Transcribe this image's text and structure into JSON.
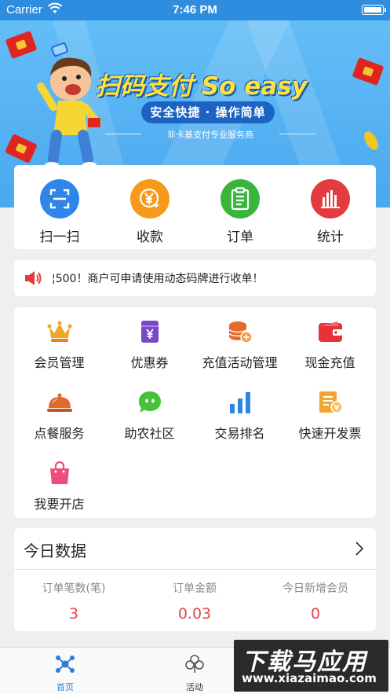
{
  "status_bar": {
    "carrier": "Carrier",
    "time": "7:46 PM"
  },
  "banner": {
    "headline": "扫码支付 So easy",
    "pill": "安全快捷 · 操作简单",
    "subline": "非卡基支付专业服务商"
  },
  "quick_actions": [
    {
      "label": "扫一扫",
      "icon": "scan-icon",
      "color": "#2f86e8"
    },
    {
      "label": "收款",
      "icon": "yuan-coin-icon",
      "color": "#f59a1b"
    },
    {
      "label": "订单",
      "icon": "clipboard-icon",
      "color": "#38b63c"
    },
    {
      "label": "统计",
      "icon": "bar-chart-icon",
      "color": "#e33b3f"
    }
  ],
  "notice": {
    "text": "500！商户可申请使用动态码牌进行收单！",
    "prefix": "¦"
  },
  "services": [
    {
      "label": "会员管理",
      "icon": "crown-icon",
      "color": "#f2a52b"
    },
    {
      "label": "优惠券",
      "icon": "coupon-icon",
      "color": "#7a47c8"
    },
    {
      "label": "充值活动管理",
      "icon": "coin-stack-icon",
      "color": "#e66a2c"
    },
    {
      "label": "现金充值",
      "icon": "wallet-icon",
      "color": "#e6333a"
    },
    {
      "label": "点餐服务",
      "icon": "cloche-icon",
      "color": "#e06a2e"
    },
    {
      "label": "助农社区",
      "icon": "chat-bubble-icon",
      "color": "#48c13a"
    },
    {
      "label": "交易排名",
      "icon": "ranking-chart-icon",
      "color": "#2d86e3"
    },
    {
      "label": "快速开发票",
      "icon": "invoice-icon",
      "color": "#f3a531"
    },
    {
      "label": "我要开店",
      "icon": "shopping-bag-icon",
      "color": "#ee4c7c"
    }
  ],
  "today": {
    "title": "今日数据",
    "items": [
      {
        "label": "订单笔数(笔)",
        "value": "3"
      },
      {
        "label": "订单金额",
        "value": "0.03"
      },
      {
        "label": "今日新增会员",
        "value": "0"
      }
    ]
  },
  "tabs": [
    {
      "label": "首页",
      "icon": "home-network-icon",
      "active": true
    },
    {
      "label": "活动",
      "icon": "clover-icon",
      "active": false
    }
  ],
  "watermark": {
    "main": "下载马应用",
    "sub": "www.xiazaimao.com"
  },
  "colors": {
    "accent": "#2f7ed8",
    "value_red": "#e8454a",
    "banner_blue": "#4aa8ef"
  }
}
